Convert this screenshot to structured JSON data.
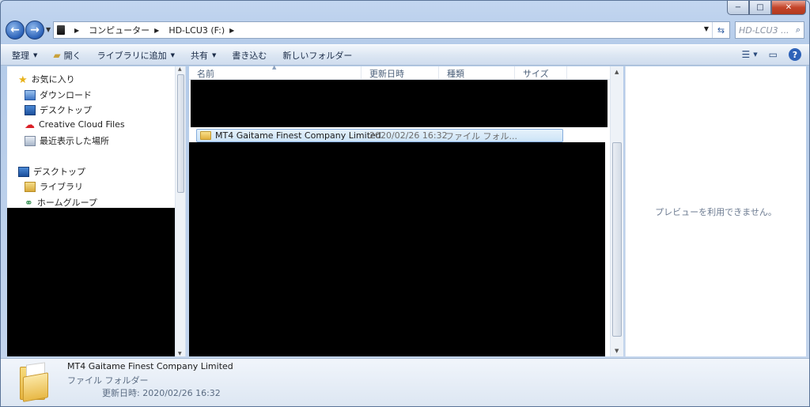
{
  "window": {
    "minimize": "−",
    "maximize": "□",
    "close": "✕"
  },
  "address": {
    "crumbs": [
      "コンピューター",
      "HD-LCU3 (F:)"
    ],
    "search_placeholder": "HD-LCU3 ..."
  },
  "toolbar": {
    "organize": "整理",
    "open": "開く",
    "add_to_library": "ライブラリに追加",
    "share": "共有",
    "burn": "書き込む",
    "new_folder": "新しいフォルダー"
  },
  "nav": {
    "favorites": "お気に入り",
    "downloads": "ダウンロード",
    "desktop": "デスクトップ",
    "creative_cloud": "Creative Cloud Files",
    "recent_places": "最近表示した場所",
    "desktop_root": "デスクトップ",
    "libraries": "ライブラリ",
    "homegroup": "ホームグループ"
  },
  "columns": {
    "name": "名前",
    "date": "更新日時",
    "type": "種類",
    "size": "サイズ"
  },
  "selected_row": {
    "name": "MT4 Gaitame Finest Company Limited",
    "date": "2020/02/26 16:32",
    "type": "ファイル フォル..."
  },
  "preview": {
    "message": "プレビューを利用できません。"
  },
  "details": {
    "name": "MT4 Gaitame Finest Company Limited",
    "type": "ファイル フォルダー",
    "date": "更新日時: 2020/02/26 16:32"
  }
}
